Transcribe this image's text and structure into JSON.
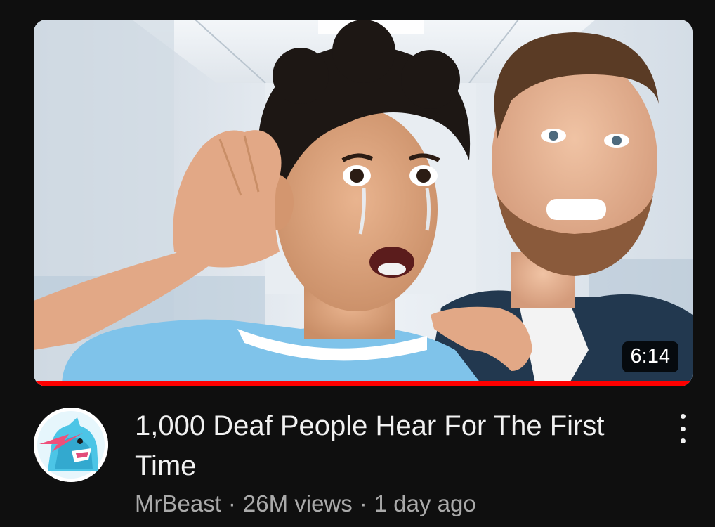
{
  "video": {
    "title": "1,000 Deaf People Hear For The First Time",
    "duration": "6:14",
    "channel": "MrBeast",
    "views": "26M views",
    "age": "1 day ago",
    "meta_separator": "·",
    "watch_progress_fraction": 1.0
  },
  "icons": {
    "avatar": "mrbeast-panther-logo",
    "more": "vertical-ellipsis-icon"
  },
  "colors": {
    "background": "#0f0f0f",
    "progress": "#ff0000",
    "title": "#f1f1f1",
    "meta": "#aaaaaa"
  }
}
